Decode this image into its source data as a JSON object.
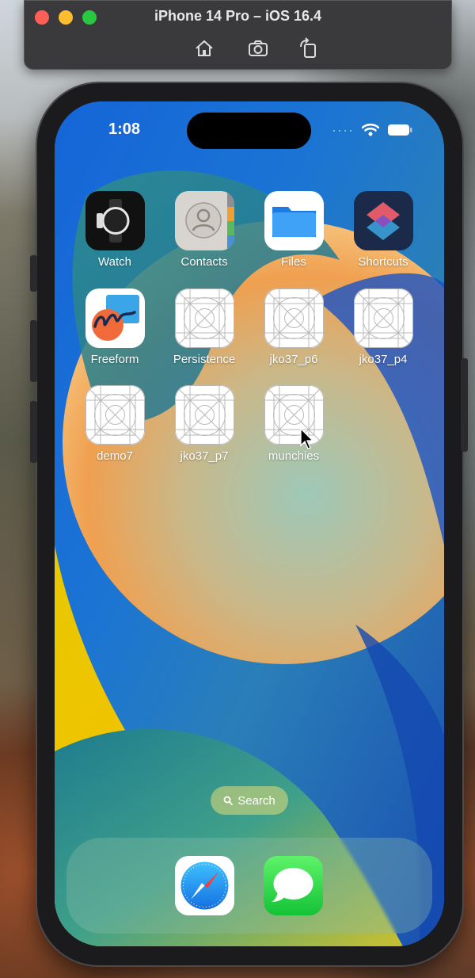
{
  "simulator": {
    "title": "iPhone 14 Pro – iOS 16.4",
    "toolbar": [
      "home-icon",
      "screenshot-icon",
      "rotate-icon"
    ]
  },
  "status_bar": {
    "time": "1:08",
    "icons": [
      "cellular-dots-icon",
      "wifi-icon",
      "battery-icon"
    ]
  },
  "apps": [
    {
      "label": "Watch",
      "icon": "watch-icon"
    },
    {
      "label": "Contacts",
      "icon": "contacts-icon"
    },
    {
      "label": "Files",
      "icon": "files-icon"
    },
    {
      "label": "Shortcuts",
      "icon": "shortcuts-icon"
    },
    {
      "label": "Freeform",
      "icon": "freeform-icon"
    },
    {
      "label": "Persistence",
      "icon": "placeholder-app-icon"
    },
    {
      "label": "jko37_p6",
      "icon": "placeholder-app-icon"
    },
    {
      "label": "jko37_p4",
      "icon": "placeholder-app-icon"
    },
    {
      "label": "demo7",
      "icon": "placeholder-app-icon"
    },
    {
      "label": "jko37_p7",
      "icon": "placeholder-app-icon"
    },
    {
      "label": "munchies",
      "icon": "placeholder-app-icon"
    }
  ],
  "search": {
    "label": "Search",
    "icon": "search-icon"
  },
  "dock": [
    {
      "name": "Safari",
      "icon": "safari-icon"
    },
    {
      "name": "Messages",
      "icon": "messages-icon"
    }
  ],
  "colors": {
    "wallpaper_blue": "#1f63c9",
    "wallpaper_orange": "#f0a050",
    "wallpaper_yellow": "#f2c200",
    "wallpaper_teal": "#2f8f86"
  }
}
